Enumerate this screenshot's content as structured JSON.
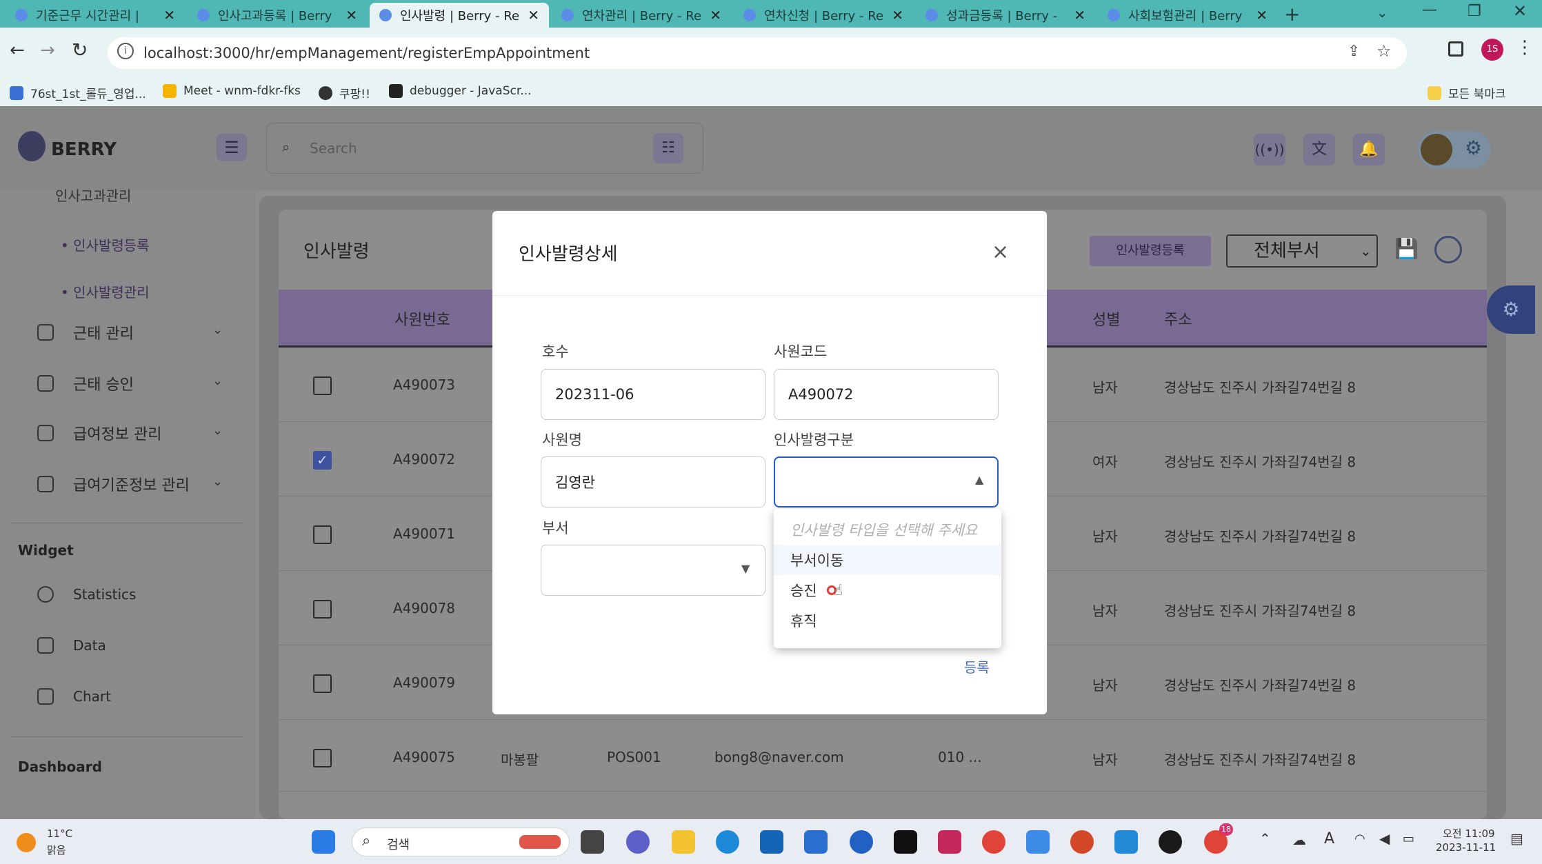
{
  "browser": {
    "tabs": [
      {
        "title": "기준근무 시간관리 |"
      },
      {
        "title": "인사고과등록 | Berry"
      },
      {
        "title": "인사발령 | Berry - Re"
      },
      {
        "title": "연차관리 | Berry - Re"
      },
      {
        "title": "연차신청 | Berry - Re"
      },
      {
        "title": "성과금등록 | Berry -"
      },
      {
        "title": "사회보험관리 | Berry"
      }
    ],
    "url": "localhost:3000/hr/empManagement/registerEmpAppointment",
    "profile_initial": "1S",
    "bookmarks": [
      "76st_1st_롤듀_영업...",
      "Meet - wnm-fdkr-fks",
      "쿠팡!!",
      "debugger - JavaScr..."
    ],
    "all_bookmarks": "모든 북마크"
  },
  "app": {
    "brand": "BERRY",
    "search_placeholder": "Search",
    "sidebar": {
      "cut_item": "인사고과관리",
      "sub_items": [
        "인사발령등록",
        "인사발령관리"
      ],
      "groups": [
        "근태 관리",
        "근태 승인",
        "급여정보 관리",
        "급여기준정보 관리"
      ],
      "widget_title": "Widget",
      "widget_items": [
        "Statistics",
        "Data",
        "Chart"
      ],
      "dashboard_title": "Dashboard"
    },
    "page_title": "인사발령",
    "register_button": "인사발령등록",
    "dept_select": "전체부서",
    "table": {
      "headers": {
        "emp_no": "사원번호",
        "gender": "성별",
        "address": "주소"
      },
      "rows": [
        {
          "id": "A490073",
          "gender": "남자",
          "address": "경상남도 진주시 가좌길74번길 8",
          "checked": false
        },
        {
          "id": "A490072",
          "gender": "여자",
          "address": "경상남도 진주시 가좌길74번길 8",
          "checked": true
        },
        {
          "id": "A490071",
          "gender": "남자",
          "address": "경상남도 진주시 가좌길74번길 8",
          "checked": false
        },
        {
          "id": "A490078",
          "gender": "남자",
          "address": "경상남도 진주시 가좌길74번길 8",
          "checked": false
        },
        {
          "id": "A490079",
          "gender": "남자",
          "address": "경상남도 진주시 가좌길74번길 8",
          "checked": false
        },
        {
          "id": "A490075",
          "name": "마봉팔",
          "pos": "POS001",
          "email": "bong8@naver.com",
          "phone": "010 ...",
          "gender": "남자",
          "address": "경상남도 진주시 가좌길74번길 8",
          "checked": false
        }
      ]
    }
  },
  "modal": {
    "title": "인사발령상세",
    "close": "×",
    "labels": {
      "number": "호수",
      "emp_code": "사원코드",
      "emp_name": "사원명",
      "appointment_type": "인사발령구분",
      "dept": "부서"
    },
    "values": {
      "number": "202311-06",
      "emp_code": "A490072",
      "emp_name": "김영란"
    },
    "dropdown": {
      "placeholder": "인사발령 타입을 선택해 주세요",
      "options": [
        "부서이동",
        "승진",
        "휴직"
      ]
    },
    "submit": "등록"
  },
  "taskbar": {
    "weather_temp": "11°C",
    "weather_desc": "맑음",
    "search": "검색",
    "time": "오전 11:09",
    "date": "2023-11-11",
    "notif_count": "18"
  },
  "colors": {
    "tabstrip": "#4fb7b4",
    "accent": "#5e35b1",
    "overlay": "#8a8a8a"
  }
}
